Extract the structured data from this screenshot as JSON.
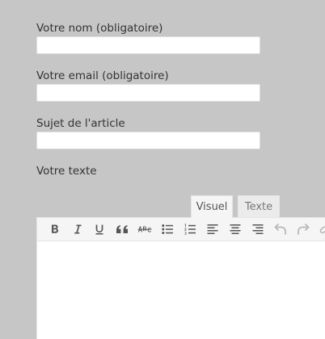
{
  "form": {
    "name_label": "Votre nom (obligatoire)",
    "name_value": "",
    "email_label": "Votre email (obligatoire)",
    "email_value": "",
    "subject_label": "Sujet de l'article",
    "subject_value": "",
    "text_label": "Votre texte"
  },
  "editor": {
    "tabs": [
      {
        "label": "Visuel",
        "active": true
      },
      {
        "label": "Texte",
        "active": false
      }
    ],
    "toolbar_icons": [
      "bold-icon",
      "italic-icon",
      "underline-icon",
      "blockquote-icon",
      "strikethrough-icon",
      "bullet-list-icon",
      "numbered-list-icon",
      "align-left-icon",
      "align-center-icon",
      "align-right-icon",
      "undo-icon",
      "redo-icon",
      "link-icon"
    ],
    "content": ""
  },
  "colors": {
    "page_background": "#c6c6c6",
    "label_text": "#333333",
    "toolbar_background": "#f5f5f5",
    "icon_color": "#555555",
    "disabled_icon_color": "#b8b8b8"
  }
}
